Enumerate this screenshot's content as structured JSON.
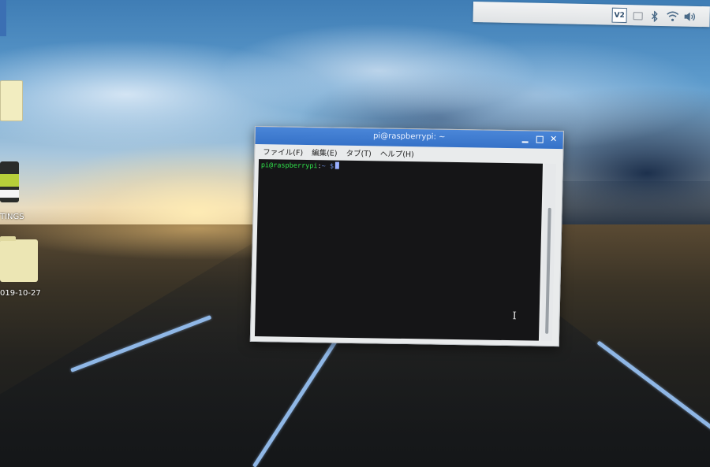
{
  "panel": {
    "vnc_label": "V2",
    "tray_icons": [
      "vnc-icon",
      "eject-icon",
      "bluetooth-icon",
      "wifi-icon",
      "volume-icon"
    ],
    "accent_color": "#3b6fb3"
  },
  "desktop": {
    "items": [
      {
        "label": "",
        "icon": "file-icon"
      },
      {
        "label": "TINGS",
        "icon": "sd-card-icon"
      },
      {
        "label": "019-10-27",
        "icon": "folder-icon"
      }
    ]
  },
  "terminal": {
    "title": "pi@raspberrypi: ~",
    "titlebar_color": "#3d7bd0",
    "menu": [
      "ファイル(F)",
      "編集(E)",
      "タブ(T)",
      "ヘルプ(H)"
    ],
    "prompt_user": "pi@raspberrypi",
    "prompt_sep": ":",
    "prompt_path": "~ $",
    "window_controls": [
      "minimize-icon",
      "maximize-icon",
      "close-icon"
    ]
  }
}
